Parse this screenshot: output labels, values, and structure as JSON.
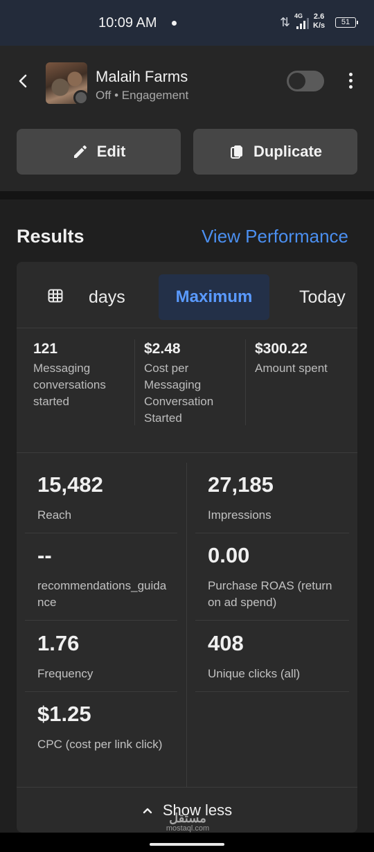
{
  "status_bar": {
    "time": "10:09 AM",
    "network": "4G",
    "speed_value": "2.6",
    "speed_unit": "K/s",
    "battery": "51"
  },
  "header": {
    "page_name": "Malaih Farms",
    "status": "Off",
    "objective": "Engagement",
    "toggle_on": false,
    "edit_label": "Edit",
    "duplicate_label": "Duplicate"
  },
  "results": {
    "title": "Results",
    "view_performance": "View Performance",
    "tabs": {
      "days": "days",
      "maximum": "Maximum",
      "today": "Today",
      "selected": "Maximum"
    },
    "top_metrics": [
      {
        "value": "121",
        "label": "Messaging conversations started"
      },
      {
        "value": "$2.48",
        "label": "Cost per Messaging Conversation Started"
      },
      {
        "value": "$300.22",
        "label": "Amount spent"
      }
    ],
    "metrics": [
      {
        "value": "15,482",
        "label": "Reach"
      },
      {
        "value": "27,185",
        "label": "Impressions"
      },
      {
        "value": "--",
        "label": "recommendations_guidance"
      },
      {
        "value": "0.00",
        "label": "Purchase ROAS (return on ad spend)"
      },
      {
        "value": "1.76",
        "label": "Frequency"
      },
      {
        "value": "408",
        "label": "Unique clicks (all)"
      },
      {
        "value": "$1.25",
        "label": "CPC (cost per link click)"
      }
    ],
    "show_less": "Show less"
  },
  "watermark": {
    "arabic": "مستقل",
    "domain": "mostaql.com"
  },
  "colors": {
    "accent_link": "#4b8ff0",
    "selected_tab_bg": "#233048",
    "selected_tab_text": "#5a9aff",
    "status_bar_bg": "#232b3a"
  }
}
